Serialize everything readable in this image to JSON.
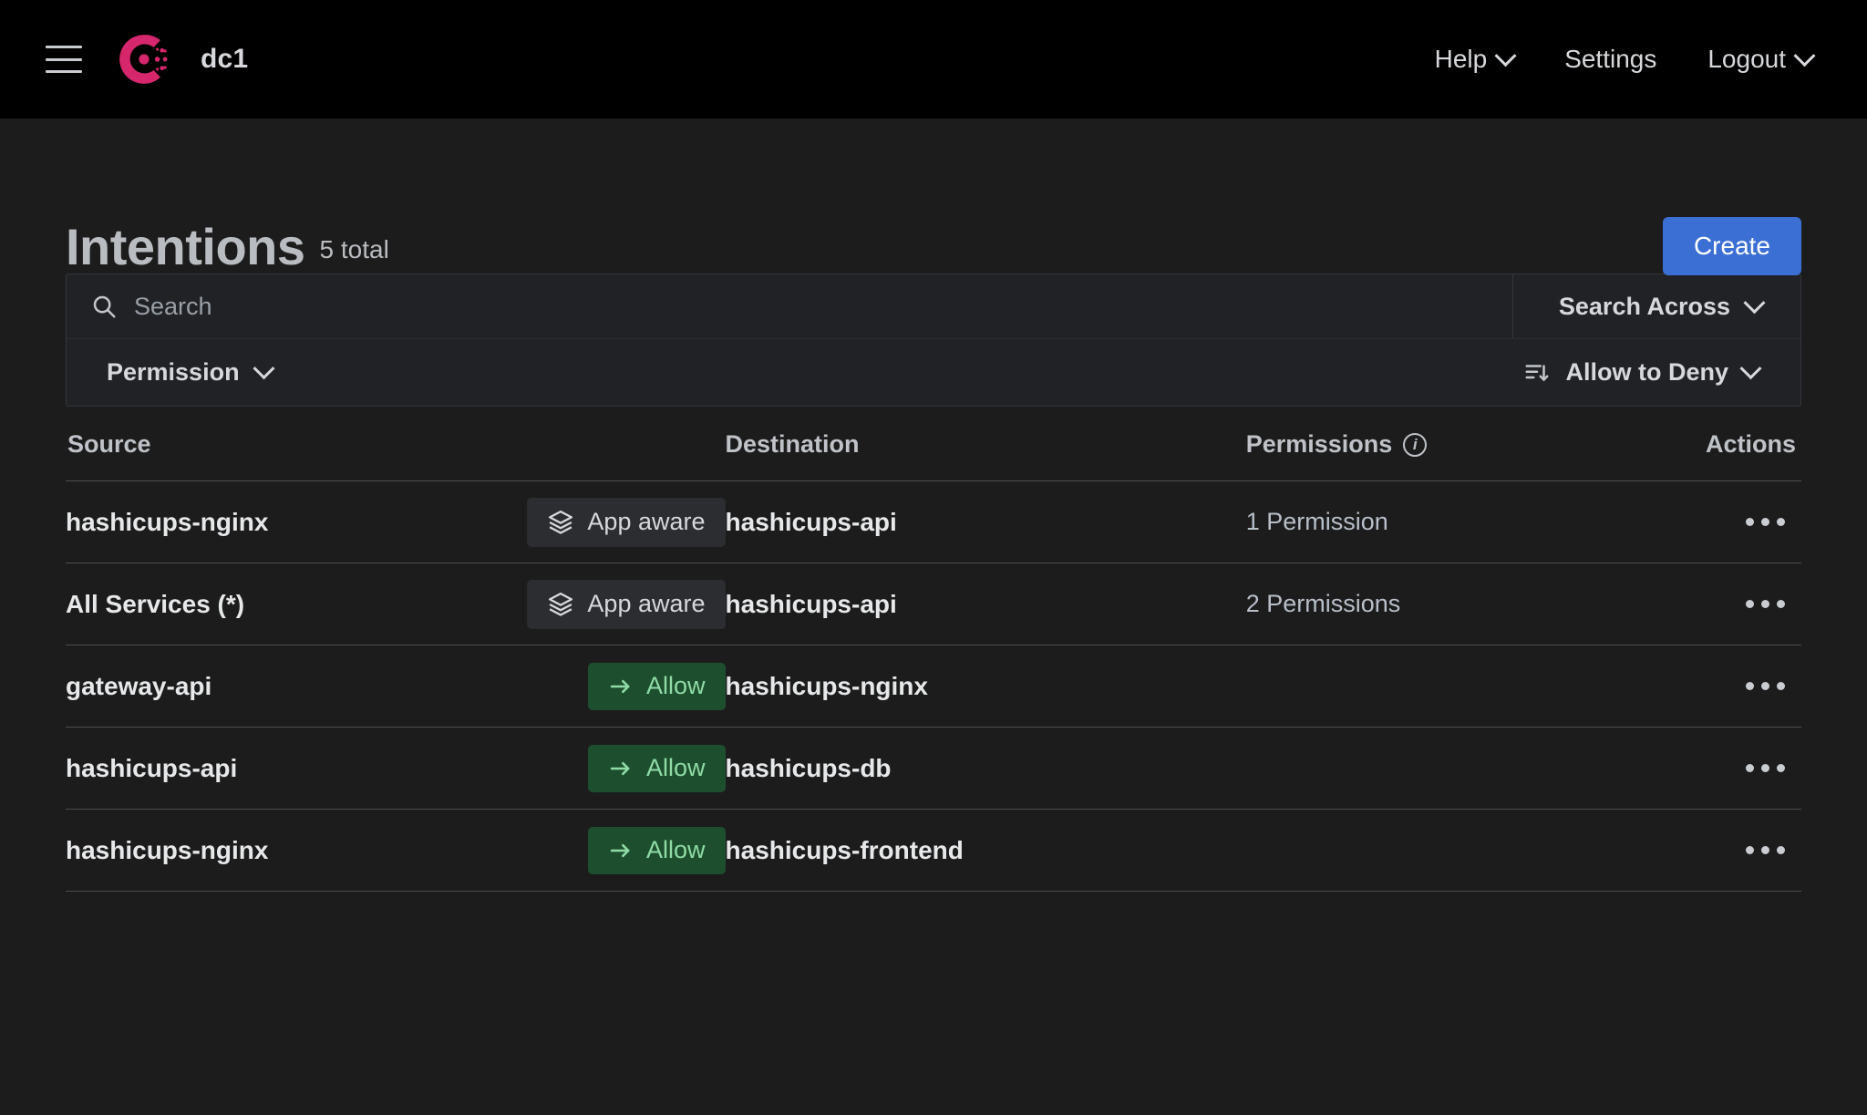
{
  "topnav": {
    "menu_icon": "hamburger-icon",
    "logo_icon": "consul-logo-icon",
    "datacenter": "dc1",
    "items": [
      {
        "label": "Help",
        "has_chevron": true
      },
      {
        "label": "Settings",
        "has_chevron": false
      },
      {
        "label": "Logout",
        "has_chevron": true
      }
    ]
  },
  "header": {
    "title": "Intentions",
    "total": "5 total",
    "create_label": "Create"
  },
  "filters": {
    "search_placeholder": "Search",
    "search_value": "",
    "search_icon": "search-icon",
    "search_across_label": "Search Across",
    "permission_label": "Permission",
    "sort_icon": "sort-descending-icon",
    "sort_label": "Allow to Deny"
  },
  "table": {
    "columns": {
      "source": "Source",
      "destination": "Destination",
      "permissions": "Permissions",
      "permissions_info_icon": "info-icon",
      "actions": "Actions"
    },
    "rows": [
      {
        "source": "hashicups-nginx",
        "badge": {
          "label": "App aware",
          "type": "app-aware",
          "icon": "layers-icon"
        },
        "destination": "hashicups-api",
        "permissions": "1 Permission",
        "actions_icon": "more-options-icon"
      },
      {
        "source": "All Services (*)",
        "badge": {
          "label": "App aware",
          "type": "app-aware",
          "icon": "layers-icon"
        },
        "destination": "hashicups-api",
        "permissions": "2 Permissions",
        "actions_icon": "more-options-icon"
      },
      {
        "source": "gateway-api",
        "badge": {
          "label": "Allow",
          "type": "allow",
          "icon": "arrow-right-icon"
        },
        "destination": "hashicups-nginx",
        "permissions": "",
        "actions_icon": "more-options-icon"
      },
      {
        "source": "hashicups-api",
        "badge": {
          "label": "Allow",
          "type": "allow",
          "icon": "arrow-right-icon"
        },
        "destination": "hashicups-db",
        "permissions": "",
        "actions_icon": "more-options-icon"
      },
      {
        "source": "hashicups-nginx",
        "badge": {
          "label": "Allow",
          "type": "allow",
          "icon": "arrow-right-icon"
        },
        "destination": "hashicups-frontend",
        "permissions": "",
        "actions_icon": "more-options-icon"
      }
    ]
  },
  "colors": {
    "brand_pink": "#d6276c",
    "accent_blue": "#3b6fd4",
    "allow_green_bg": "#1d4f2e",
    "allow_green_text": "#8fdba6",
    "header_bg": "#000000",
    "page_bg": "#1c1c1c"
  }
}
